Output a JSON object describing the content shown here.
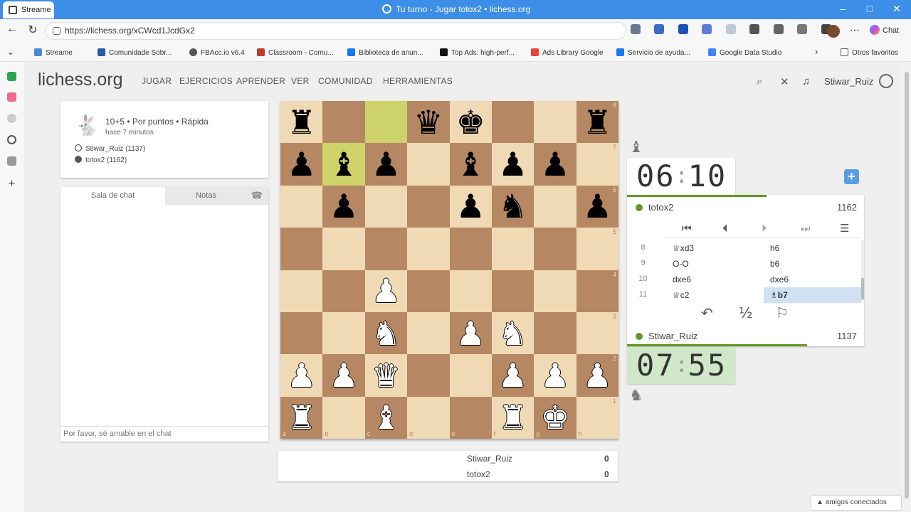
{
  "browser": {
    "tab_title": "Streame",
    "window_title": "Tu turno - Jugar totox2 • lichess.org",
    "url": "https://lichess.org/xCWcd1JcdGx2",
    "copilot_label": "Chat",
    "bookmarks": [
      {
        "label": "Streame",
        "color": "#4a8ad4"
      },
      {
        "label": "Comunidade Sobr...",
        "color": "#2a5aa0"
      },
      {
        "label": "FBAcc.io v6.4",
        "color": "#555555"
      },
      {
        "label": "Classroom - Comu...",
        "color": "#c0392b"
      },
      {
        "label": "Biblioteca de anun...",
        "color": "#1877f2"
      },
      {
        "label": "Top Ads: high-perf...",
        "color": "#111111"
      },
      {
        "label": "Ads Library Google",
        "color": "#ea4335"
      },
      {
        "label": "Servicio de ayuda...",
        "color": "#1877f2"
      },
      {
        "label": "Google Data Studio",
        "color": "#4285f4"
      }
    ],
    "other_favorites": "Otros favoritos"
  },
  "site": {
    "logo": "lichess.org",
    "nav": [
      "JUGAR",
      "EJERCICIOS",
      "APRENDER",
      "VER",
      "COMUNIDAD",
      "HERRAMIENTAS"
    ],
    "username": "Stiwar_Ruiz"
  },
  "game_info": {
    "type": "10+5 • Por puntos • Rápida",
    "time_ago": "hace 7 minutos",
    "white_player": "Stiwar_Ruiz (1137)",
    "black_player": "totox2 (1162)"
  },
  "chat": {
    "tab_chat": "Sala de chat",
    "tab_notes": "Notas",
    "placeholder": "Por favor, sé amable en el chat"
  },
  "board": {
    "ranks": [
      [
        "bR",
        "",
        "",
        "bQ",
        "bK",
        "",
        "",
        "bR"
      ],
      [
        "bP",
        "bB",
        "bP",
        "",
        "bB",
        "bP",
        "bP",
        ""
      ],
      [
        "",
        "bP",
        "",
        "",
        "bP",
        "bN",
        "",
        "bP"
      ],
      [
        "",
        "",
        "",
        "",
        "",
        "",
        "",
        ""
      ],
      [
        "",
        "",
        "wP",
        "",
        "",
        "",
        "",
        ""
      ],
      [
        "",
        "",
        "wN",
        "",
        "wP",
        "wN",
        "",
        ""
      ],
      [
        "wP",
        "wP",
        "wQ",
        "",
        "",
        "wP",
        "wP",
        "wP"
      ],
      [
        "wR",
        "",
        "wB",
        "",
        "",
        "wR",
        "wK",
        ""
      ]
    ],
    "highlight": [
      "c8",
      "b7"
    ],
    "file_labels": [
      "a",
      "b",
      "c",
      "d",
      "e",
      "f",
      "g",
      "h"
    ],
    "rank_labels": [
      "8",
      "7",
      "6",
      "5",
      "4",
      "3",
      "2",
      "1"
    ]
  },
  "score": {
    "rows": [
      {
        "name": "Stiwar_Ruiz",
        "value": "0"
      },
      {
        "name": "totox2",
        "value": "0"
      }
    ]
  },
  "opponent": {
    "name": "totox2",
    "rating": "1162",
    "clock_min": "06",
    "clock_sec": "10",
    "time_fraction": 0.59
  },
  "me": {
    "name": "Stiwar_Ruiz",
    "rating": "1137",
    "clock_min": "07",
    "clock_sec": "55",
    "time_fraction": 0.76
  },
  "moves": [
    {
      "num": "8",
      "white": "♕xd3",
      "black": "h6"
    },
    {
      "num": "9",
      "white": "O-O",
      "black": "b6"
    },
    {
      "num": "10",
      "white": "dxe6",
      "black": "dxe6"
    },
    {
      "num": "11",
      "white": "♕c2",
      "black": "♗b7"
    }
  ],
  "current_move_index": 3,
  "friends_label": "amigos conectados",
  "icons": {
    "half": "½"
  }
}
